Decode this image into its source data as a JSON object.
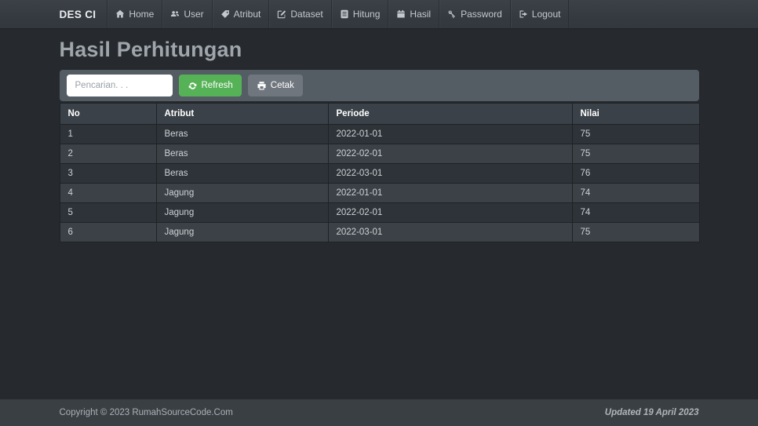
{
  "navbar": {
    "brand": "DES CI",
    "items": [
      {
        "label": "Home",
        "icon": "home-icon"
      },
      {
        "label": "User",
        "icon": "users-icon"
      },
      {
        "label": "Atribut",
        "icon": "tag-icon"
      },
      {
        "label": "Dataset",
        "icon": "edit-icon"
      },
      {
        "label": "Hitung",
        "icon": "list-icon"
      },
      {
        "label": "Hasil",
        "icon": "calendar-icon"
      },
      {
        "label": "Password",
        "icon": "key-icon"
      },
      {
        "label": "Logout",
        "icon": "logout-icon"
      }
    ]
  },
  "page": {
    "title": "Hasil Perhitungan"
  },
  "toolbar": {
    "search_placeholder": "Pencarian. . .",
    "refresh_label": "Refresh",
    "cetak_label": "Cetak"
  },
  "table": {
    "headers": [
      "No",
      "Atribut",
      "Periode",
      "Nilai"
    ],
    "rows": [
      [
        "1",
        "Beras",
        "2022-01-01",
        "75"
      ],
      [
        "2",
        "Beras",
        "2022-02-01",
        "75"
      ],
      [
        "3",
        "Beras",
        "2022-03-01",
        "76"
      ],
      [
        "4",
        "Jagung",
        "2022-01-01",
        "74"
      ],
      [
        "5",
        "Jagung",
        "2022-02-01",
        "74"
      ],
      [
        "6",
        "Jagung",
        "2022-03-01",
        "75"
      ]
    ]
  },
  "footer": {
    "copyright": "Copyright © 2023 RumahSourceCode.Com",
    "updated": "Updated 19 April 2023"
  },
  "colors": {
    "page_bg": "#26292e",
    "navbar_bg": "#383d43",
    "panel_bg": "#545c64",
    "accent_green": "#56b257",
    "button_gray": "#6f767d",
    "row_dark": "#2e3339",
    "row_light": "#3c4147"
  }
}
